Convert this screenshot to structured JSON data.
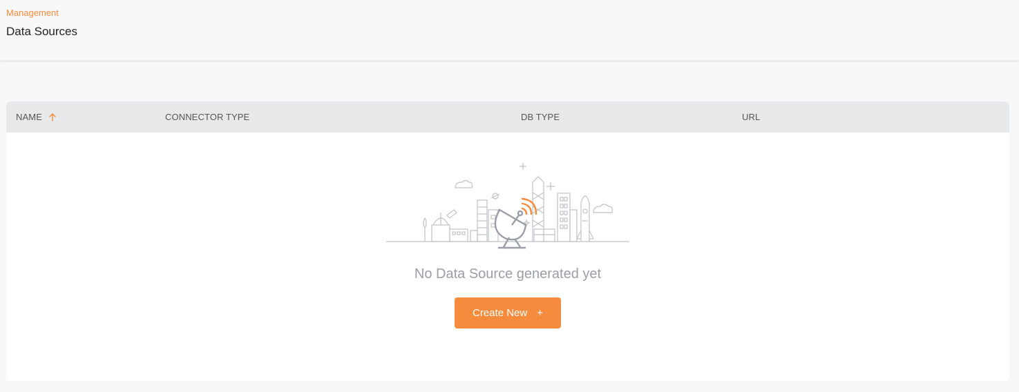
{
  "header": {
    "breadcrumb": "Management",
    "title": "Data Sources"
  },
  "table": {
    "columns": [
      {
        "label": "NAME",
        "sorted": "ascending"
      },
      {
        "label": "CONNECTOR TYPE"
      },
      {
        "label": "DB TYPE"
      },
      {
        "label": "URL"
      }
    ],
    "rows": []
  },
  "empty_state": {
    "illustration": "satellite-dish-city-illustration",
    "message": "No Data Source generated yet",
    "button_label": "Create New",
    "button_icon": "plus-icon"
  },
  "colors": {
    "accent": "#f58b3c",
    "header_bg": "#e8e9eb",
    "muted_text": "#9a9ea6"
  }
}
